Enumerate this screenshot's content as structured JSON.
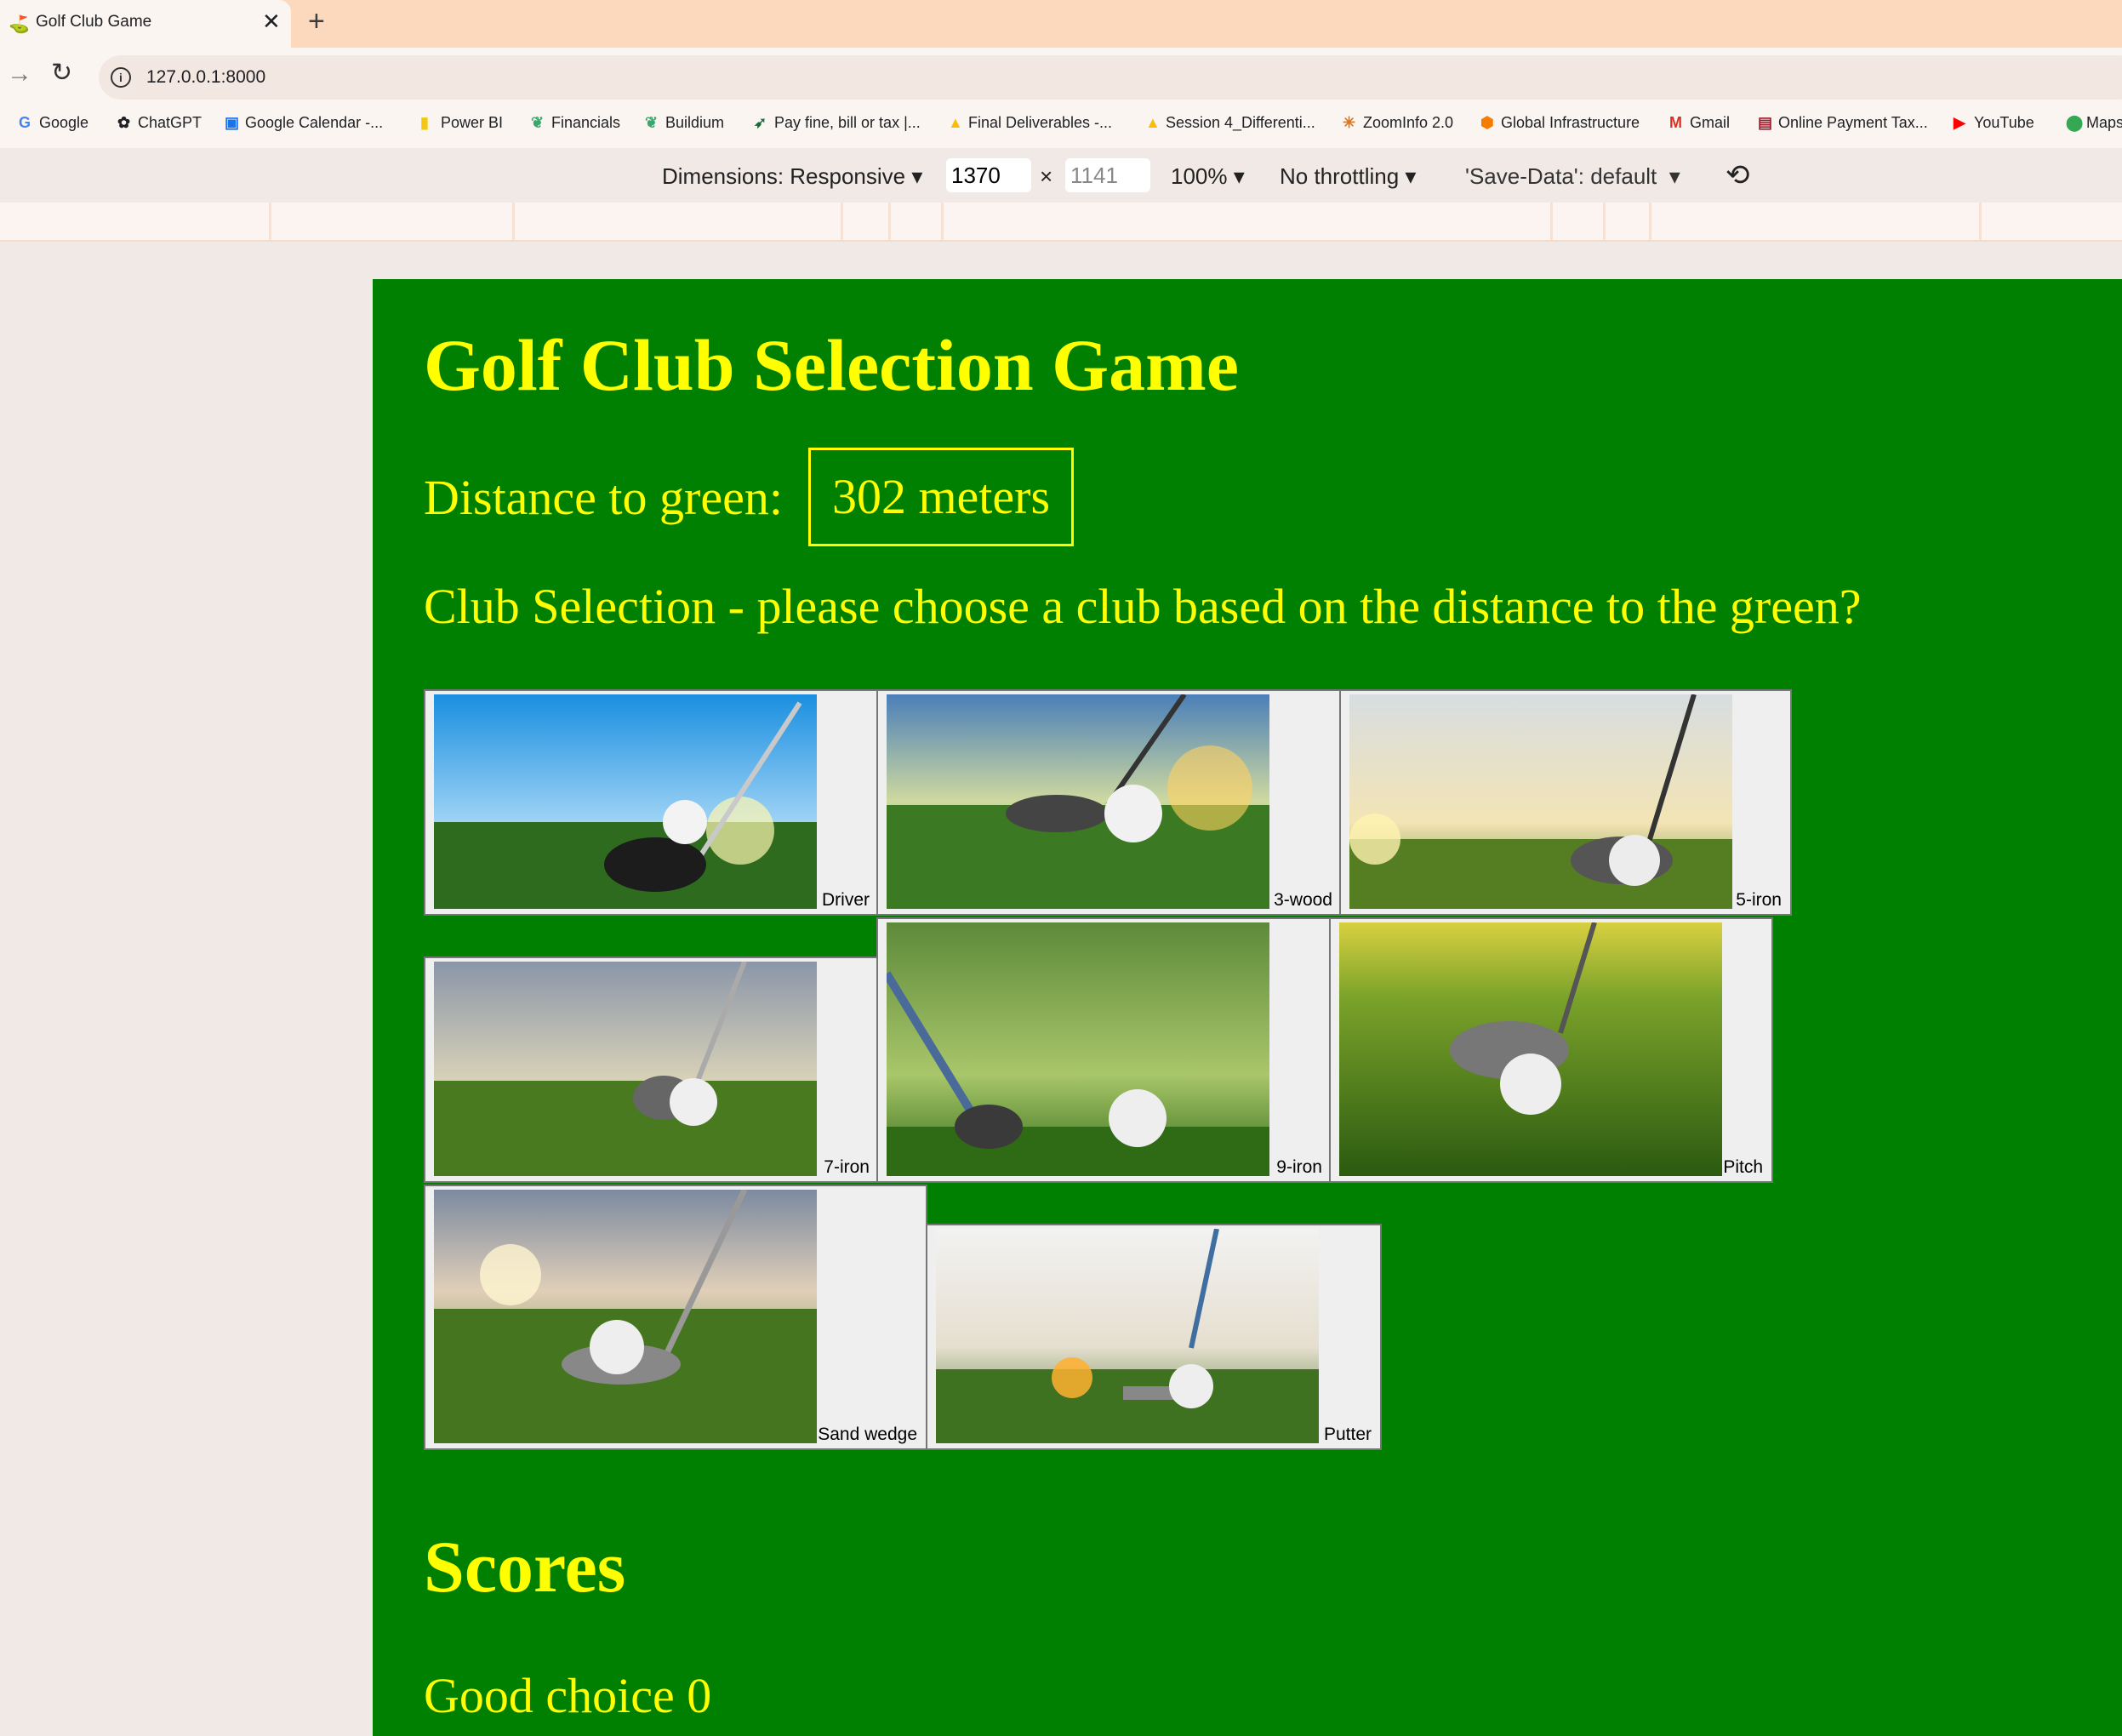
{
  "browser": {
    "tab_title": "Golf Club Game",
    "url": "127.0.0.1:8000",
    "bookmarks": [
      {
        "label": "Google",
        "icon": "google-icon"
      },
      {
        "label": "ChatGPT",
        "icon": "chatgpt-icon"
      },
      {
        "label": "Google Calendar -...",
        "icon": "calendar-icon"
      },
      {
        "label": "Power BI",
        "icon": "powerbi-icon"
      },
      {
        "label": "Financials",
        "icon": "leaf-icon"
      },
      {
        "label": "Buildium",
        "icon": "leaf-icon"
      },
      {
        "label": "Pay fine, bill or tax |...",
        "icon": "bird-icon"
      },
      {
        "label": "Final Deliverables -...",
        "icon": "drive-icon"
      },
      {
        "label": "Session 4_Differenti...",
        "icon": "drive-icon"
      },
      {
        "label": "ZoomInfo 2.0",
        "icon": "asterisk-icon"
      },
      {
        "label": "Global Infrastructure",
        "icon": "cube-icon"
      },
      {
        "label": "Gmail",
        "icon": "gmail-icon"
      },
      {
        "label": "Online Payment Tax...",
        "icon": "payment-icon"
      },
      {
        "label": "YouTube",
        "icon": "youtube-icon"
      },
      {
        "label": "Maps",
        "icon": "maps-icon"
      }
    ]
  },
  "devtools": {
    "dimensions_label": "Dimensions: Responsive",
    "width_value": "1370",
    "times": "×",
    "height_value": "1141",
    "zoom": "100%",
    "throttling": "No throttling",
    "save_data": "'Save-Data': default"
  },
  "game": {
    "title": "Golf Club Selection Game",
    "distance_label": "Distance to green:",
    "distance_value": "302 meters",
    "prompt": "Club Selection - please choose a club based on the distance to the green?",
    "clubs": [
      {
        "label": "Driver"
      },
      {
        "label": "3-wood"
      },
      {
        "label": "5-iron"
      },
      {
        "label": "7-iron"
      },
      {
        "label": "9-iron"
      },
      {
        "label": "Pitch"
      },
      {
        "label": "Sand wedge"
      },
      {
        "label": "Putter"
      }
    ]
  },
  "scores": {
    "title": "Scores",
    "good_choice": "Good choice 0"
  },
  "colors": {
    "page_background": "#008000",
    "text": "#ffff00",
    "tabbar": "#fcd9bd"
  }
}
